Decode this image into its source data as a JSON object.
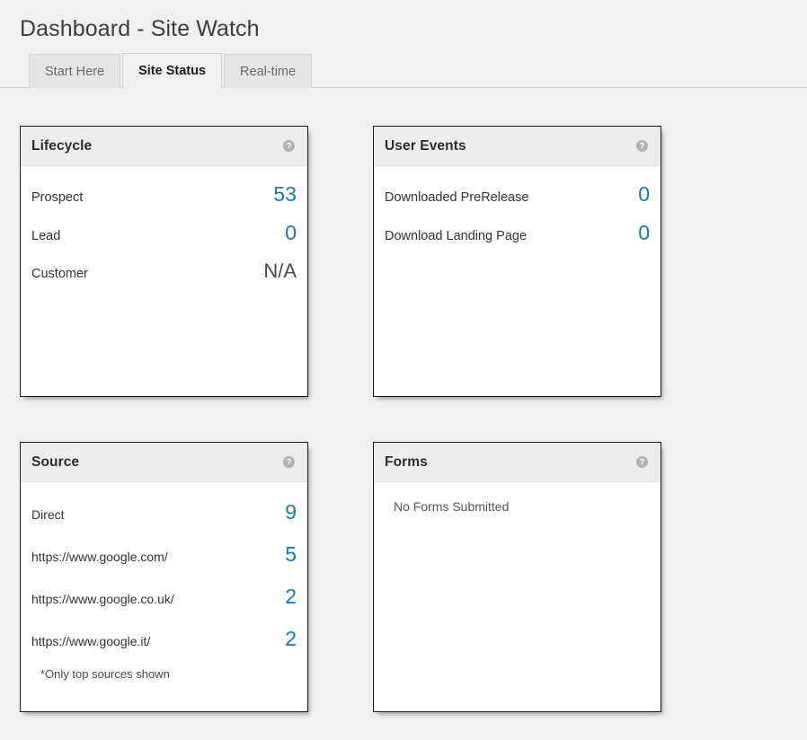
{
  "page": {
    "title": "Dashboard - Site Watch",
    "background_color": "#f0f0f0",
    "accent_color": "#1779a8"
  },
  "tabs": [
    {
      "label": "Start Here",
      "active": false
    },
    {
      "label": "Site Status",
      "active": true
    },
    {
      "label": "Real-time",
      "active": false
    }
  ],
  "help_icon_glyph": "?",
  "panels": {
    "lifecycle": {
      "title": "Lifecycle",
      "help_icon": "question-circle-icon",
      "rows": [
        {
          "label": "Prospect",
          "value": "53"
        },
        {
          "label": "Lead",
          "value": "0"
        },
        {
          "label": "Customer",
          "value": "N/A"
        }
      ]
    },
    "user_events": {
      "title": "User Events",
      "help_icon": "question-circle-icon",
      "rows": [
        {
          "label": "Downloaded PreRelease",
          "value": "0"
        },
        {
          "label": "Download Landing Page",
          "value": "0"
        }
      ]
    },
    "source": {
      "title": "Source",
      "help_icon": "question-circle-icon",
      "rows": [
        {
          "label": "Direct",
          "value": "9"
        },
        {
          "label": "https://www.google.com/",
          "value": "5"
        },
        {
          "label": "https://www.google.co.uk/",
          "value": "2"
        },
        {
          "label": "https://www.google.it/",
          "value": "2"
        }
      ],
      "footnote": "*Only top sources shown"
    },
    "forms": {
      "title": "Forms",
      "help_icon": "question-circle-icon",
      "empty_message": "No Forms Submitted"
    }
  }
}
